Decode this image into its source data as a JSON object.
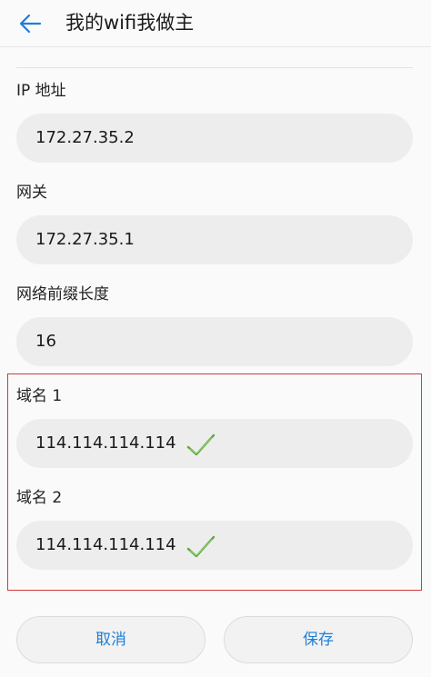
{
  "header": {
    "title": "我的wifi我做主"
  },
  "fields": [
    {
      "label": "IP 地址",
      "value": "172.27.35.2"
    },
    {
      "label": "网关",
      "value": "172.27.35.1"
    },
    {
      "label": "网络前缀长度",
      "value": "16"
    },
    {
      "label": "域名 1",
      "value": "114.114.114.114"
    },
    {
      "label": "域名 2",
      "value": "114.114.114.114"
    }
  ],
  "buttons": {
    "cancel": "取消",
    "save": "保存"
  },
  "colors": {
    "accent": "#1e7fd8",
    "highlight": "#d23a3a",
    "check": "#5da63b"
  },
  "icons": {
    "back": "back-arrow-icon",
    "check": "checkmark-icon"
  }
}
